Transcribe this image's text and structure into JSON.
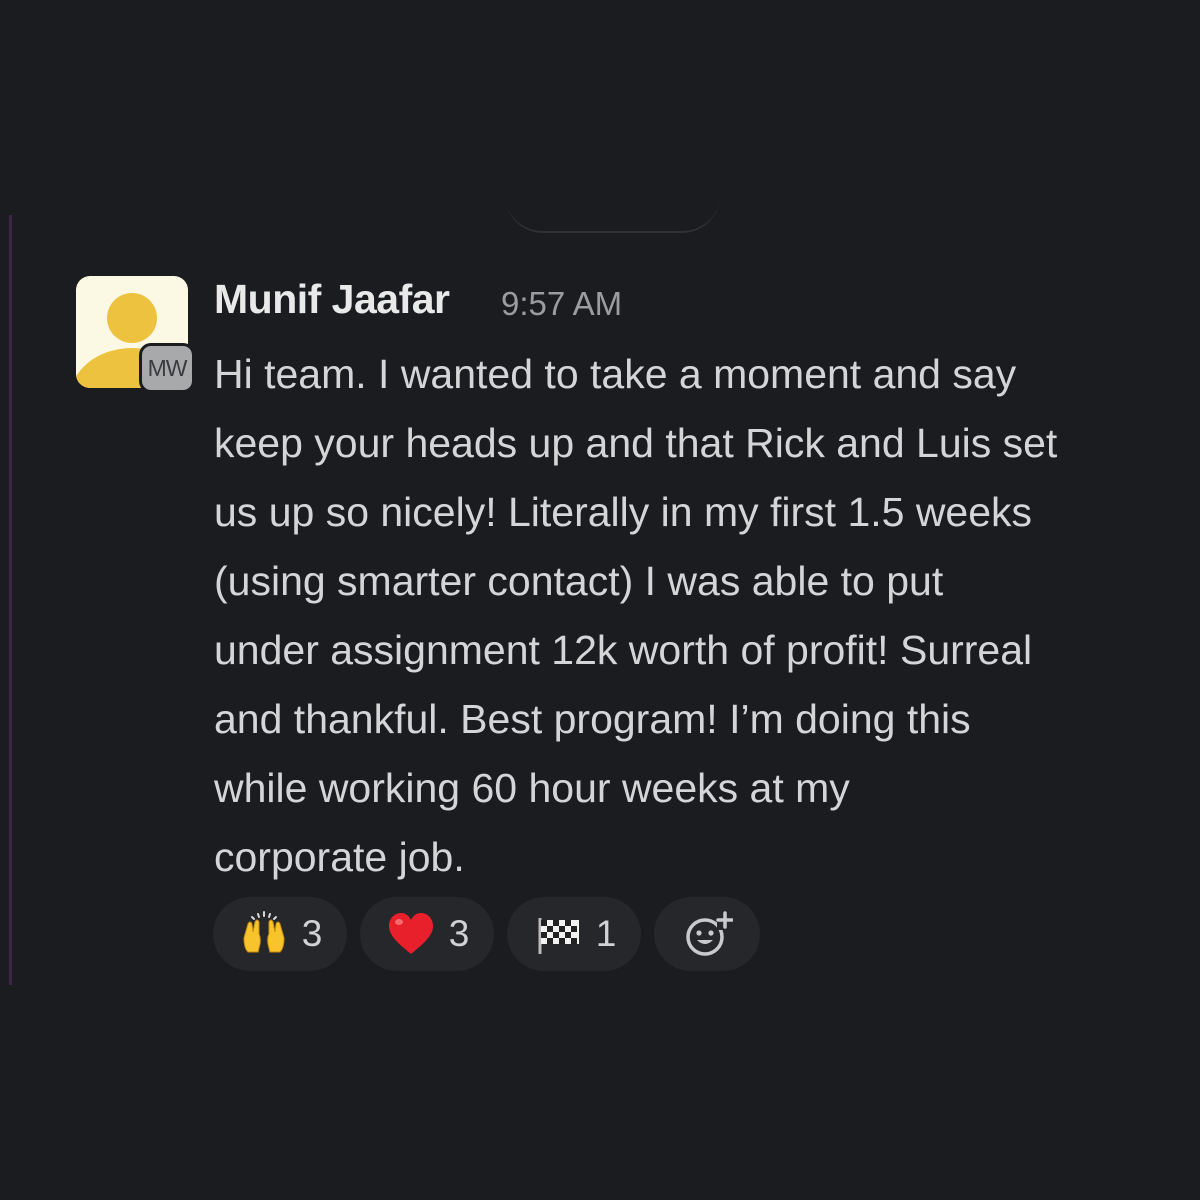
{
  "message": {
    "sender": "Munif Jaafar",
    "time": "9:57 AM",
    "avatar_badge": "MW",
    "lines": [
      "Hi team. I wanted to take a moment and say",
      "keep your heads up and that Rick and Luis set",
      "us up so nicely! Literally in my first 1.5 weeks",
      "(using smarter contact) I was able to put",
      "under assignment 12k worth of profit! Surreal",
      "and thankful. Best program! I’m doing this",
      "while working 60 hour weeks at my",
      "corporate job."
    ]
  },
  "reactions": [
    {
      "emoji": "raised-hands",
      "count": "3"
    },
    {
      "emoji": "red-heart",
      "count": "3"
    },
    {
      "emoji": "checkered-flag",
      "count": "1"
    },
    {
      "emoji": "add-reaction-icon"
    }
  ],
  "colors": {
    "background": "#1b1c1f",
    "thread_bar": "#3d2347",
    "reaction_pill": "#26272b",
    "avatar_bg": "#fbf8e4",
    "avatar_figure": "#edc23e"
  }
}
